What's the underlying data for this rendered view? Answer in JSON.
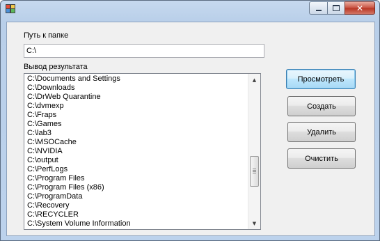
{
  "window": {
    "title": "",
    "app_icon": "app-icon",
    "caption_buttons": {
      "minimize_icon": "minimize-icon",
      "maximize_icon": "maximize-icon",
      "close_glyph": "✕"
    }
  },
  "form": {
    "path_label": "Путь к папке",
    "path_value": "C:\\",
    "output_label": "Вывод результата",
    "output_items": [
      "C:\\Documents and Settings",
      "C:\\Downloads",
      "C:\\DrWeb Quarantine",
      "C:\\dvmexp",
      "C:\\Fraps",
      "C:\\Games",
      "C:\\lab3",
      "C:\\MSOCache",
      "C:\\NVIDIA",
      "C:\\output",
      "C:\\PerfLogs",
      "C:\\Program Files",
      "C:\\Program Files (x86)",
      "C:\\ProgramData",
      "C:\\Recovery",
      "C:\\RECYCLER",
      "C:\\System Volume Information"
    ],
    "scroll_up_glyph": "▲",
    "scroll_down_glyph": "▼"
  },
  "buttons": {
    "view": "Просмотреть",
    "create": "Создать",
    "delete": "Удалить",
    "clear": "Очистить"
  },
  "colors": {
    "titlebar": "#c6d9ef",
    "client_bg": "#f0f0f0",
    "close_button": "#c75040",
    "primary_button_border": "#3c7fb1"
  }
}
